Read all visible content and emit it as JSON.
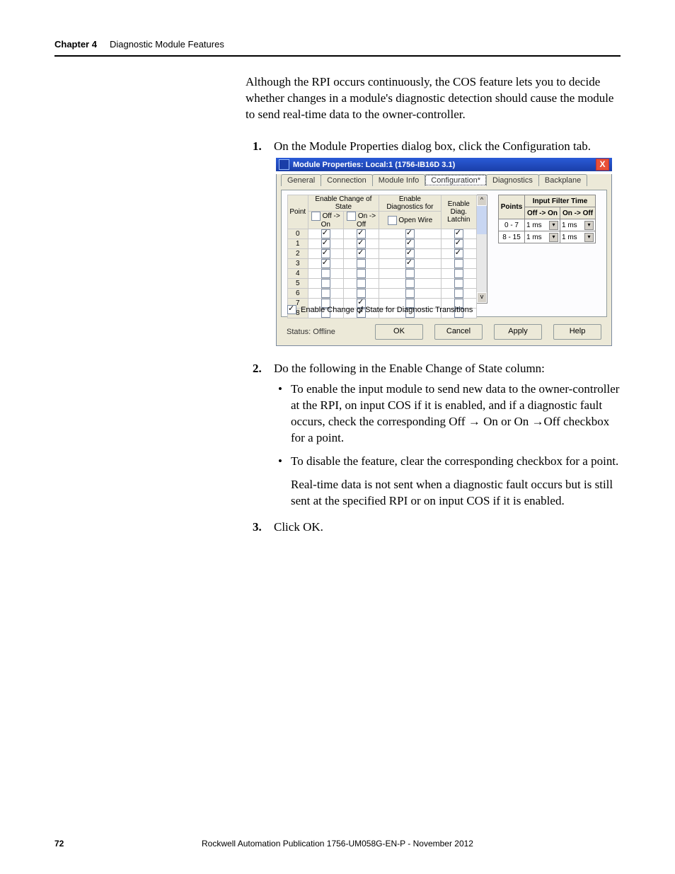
{
  "header": {
    "chapter": "Chapter 4",
    "title": "Diagnostic Module Features"
  },
  "para_intro": "Although the RPI occurs continuously, the COS feature lets you to decide whether changes in a module's diagnostic detection should cause the module to send real-time data to the owner-controller.",
  "steps": {
    "s1": {
      "num": "1.",
      "text": "On the Module Properties dialog box, click the Configuration tab."
    },
    "s2": {
      "num": "2.",
      "text": "Do the following in the Enable Change of State column:",
      "b1": "To enable the input module to send new data to the owner-controller at the RPI, on input COS if it is enabled, and if a diagnostic fault occurs, check the corresponding Off → On or On →Off checkbox for a point.",
      "b2": "To disable the feature, clear the corresponding checkbox for a point.",
      "b2_sub": "Real-time data is not sent when a diagnostic fault occurs but is still sent at the specified RPI or on input COS if it is enabled."
    },
    "s3": {
      "num": "3.",
      "text": "Click OK."
    }
  },
  "footer": {
    "page": "72",
    "pub": "Rockwell Automation Publication 1756-UM058G-EN-P - November 2012"
  },
  "dialog": {
    "title": "Module Properties: Local:1 (1756-IB16D 3.1)",
    "tabs": [
      "General",
      "Connection",
      "Module Info",
      "Configuration*",
      "Diagnostics",
      "Backplane"
    ],
    "active_tab": 3,
    "grid": {
      "hdr_point": "Point",
      "hdr_group_cos": "Enable Change of State",
      "hdr_group_diag": "Enable Diagnostics for",
      "hdr_off_on": "Off -> On",
      "hdr_on_off": "On -> Off",
      "hdr_open_wire": "Open Wire",
      "hdr_enable_diag_latch": "Enable Diag. Latchin",
      "rows": [
        {
          "pt": "0",
          "off_on": true,
          "on_off": true,
          "open": true,
          "diag": true
        },
        {
          "pt": "1",
          "off_on": true,
          "on_off": true,
          "open": true,
          "diag": true
        },
        {
          "pt": "2",
          "off_on": true,
          "on_off": true,
          "open": true,
          "diag": true
        },
        {
          "pt": "3",
          "off_on": true,
          "on_off": false,
          "open": true,
          "diag": false
        },
        {
          "pt": "4",
          "off_on": false,
          "on_off": false,
          "open": false,
          "diag": false
        },
        {
          "pt": "5",
          "off_on": false,
          "on_off": false,
          "open": false,
          "diag": false
        },
        {
          "pt": "6",
          "off_on": false,
          "on_off": false,
          "open": false,
          "diag": false
        },
        {
          "pt": "7",
          "off_on": false,
          "on_off": true,
          "open": false,
          "diag": false
        },
        {
          "pt": "8",
          "off_on": false,
          "on_off": true,
          "open": false,
          "diag": false
        }
      ]
    },
    "cos_transitions": {
      "label": "Enable Change of State for Diagnostic Transitions",
      "checked": true
    },
    "filter": {
      "title": "Input Filter Time",
      "points_hdr": "Points",
      "off_on_hdr": "Off -> On",
      "on_off_hdr": "On -> Off",
      "rows": [
        {
          "range": "0 - 7",
          "off_on": "1 ms",
          "on_off": "1 ms"
        },
        {
          "range": "8 - 15",
          "off_on": "1 ms",
          "on_off": "1 ms"
        }
      ]
    },
    "status": "Status:  Offline",
    "buttons": {
      "ok": "OK",
      "cancel": "Cancel",
      "apply": "Apply",
      "help": "Help"
    }
  }
}
